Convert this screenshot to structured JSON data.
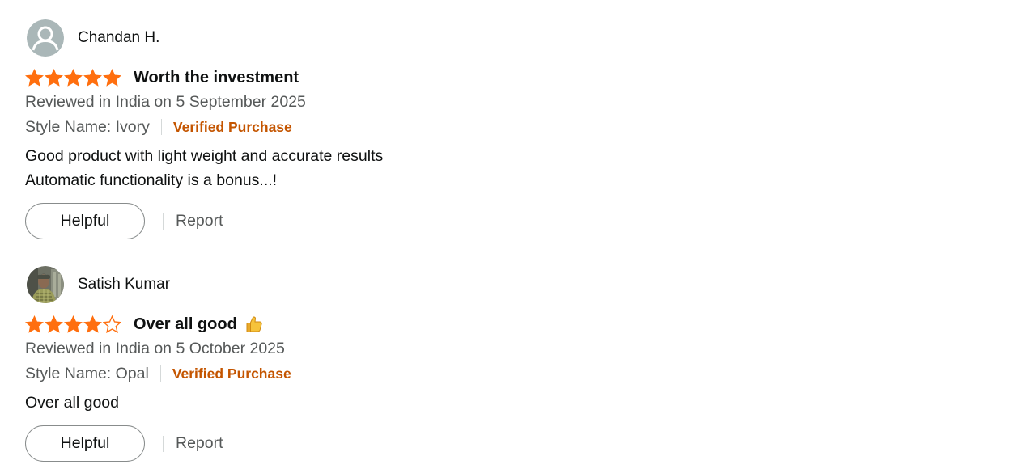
{
  "colors": {
    "star": "#ff6f0f",
    "verified": "#c45500",
    "secondary_text": "#565959",
    "primary_text": "#0f1111"
  },
  "reviews": [
    {
      "profile_name": "Chandan H.",
      "avatar": "default-avatar-icon",
      "rating": 5,
      "rating_max": 5,
      "title": "Worth the investment",
      "title_emoji": "",
      "date_text": "Reviewed in India on 5 September 2025",
      "style_text": "Style Name: Ivory",
      "verified_label": "Verified Purchase",
      "body_lines": [
        "Good product with light weight and accurate results",
        "Automatic functionality is a bonus...!"
      ],
      "helpful_label": "Helpful",
      "report_label": "Report"
    },
    {
      "profile_name": "Satish Kumar",
      "avatar": "photo-avatar",
      "rating": 4,
      "rating_max": 5,
      "title": "Over all good",
      "title_emoji": "thumbs-up-icon",
      "date_text": "Reviewed in India on 5 October 2025",
      "style_text": "Style Name: Opal",
      "verified_label": "Verified Purchase",
      "body_lines": [
        "Over all good"
      ],
      "helpful_label": "Helpful",
      "report_label": "Report"
    }
  ]
}
